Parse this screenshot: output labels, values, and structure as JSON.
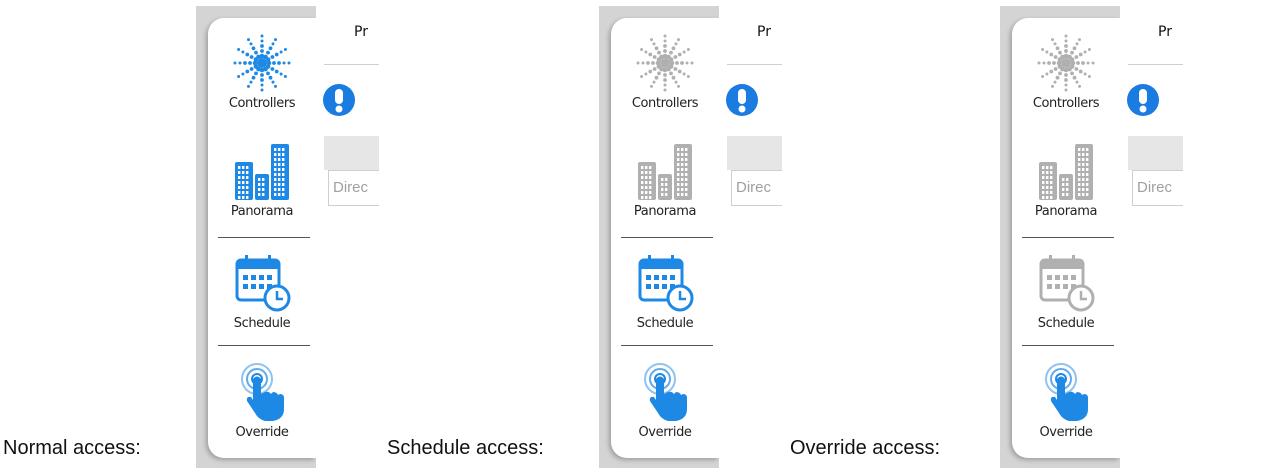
{
  "colors": {
    "active": "#1e88e5",
    "disabled": "#b0b0b0",
    "alert": "#1a7be0"
  },
  "panels": [
    {
      "caption": "Normal access:",
      "tab_title": "Pr",
      "input_placeholder": "Direc",
      "items": [
        {
          "label": "Controllers",
          "icon": "controllers-icon",
          "state": "active"
        },
        {
          "label": "Panorama",
          "icon": "panorama-icon",
          "state": "active"
        },
        {
          "label": "Schedule",
          "icon": "schedule-icon",
          "state": "active"
        },
        {
          "label": "Override",
          "icon": "override-icon",
          "state": "active"
        }
      ]
    },
    {
      "caption": "Schedule access:",
      "tab_title": "Pr",
      "input_placeholder": "Direc",
      "items": [
        {
          "label": "Controllers",
          "icon": "controllers-icon",
          "state": "disabled"
        },
        {
          "label": "Panorama",
          "icon": "panorama-icon",
          "state": "disabled"
        },
        {
          "label": "Schedule",
          "icon": "schedule-icon",
          "state": "active"
        },
        {
          "label": "Override",
          "icon": "override-icon",
          "state": "active"
        }
      ]
    },
    {
      "caption": "Override access:",
      "tab_title": "Pr",
      "input_placeholder": "Direc",
      "items": [
        {
          "label": "Controllers",
          "icon": "controllers-icon",
          "state": "disabled"
        },
        {
          "label": "Panorama",
          "icon": "panorama-icon",
          "state": "disabled"
        },
        {
          "label": "Schedule",
          "icon": "schedule-icon",
          "state": "disabled"
        },
        {
          "label": "Override",
          "icon": "override-icon",
          "state": "active"
        }
      ]
    }
  ]
}
